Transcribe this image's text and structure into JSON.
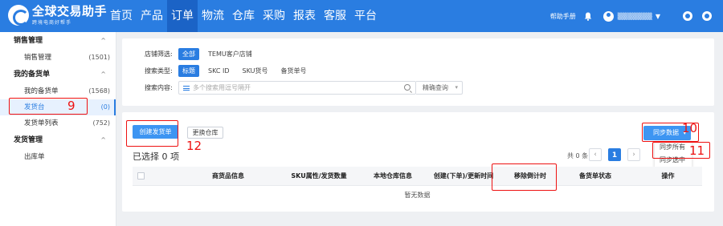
{
  "app": {
    "logo_title": "全球交易助手",
    "logo_sub": "跨境电商好帮手"
  },
  "nav": {
    "items": [
      "首页",
      "产品",
      "订单",
      "物流",
      "仓库",
      "采购",
      "报表",
      "客服",
      "平台"
    ],
    "active_index": 2
  },
  "header": {
    "help": "帮助手册",
    "username": "▒▒▒▒▒▒▒"
  },
  "sidebar": {
    "groups": [
      {
        "label": "销售管理",
        "items": [
          {
            "label": "销售管理",
            "count": "(1501)"
          }
        ]
      },
      {
        "label": "我的备货单",
        "items": [
          {
            "label": "我的备货单",
            "count": "(1568)"
          },
          {
            "label": "发货台",
            "count": "(0)"
          },
          {
            "label": "发货单列表",
            "count": "(752)"
          }
        ]
      },
      {
        "label": "发货管理",
        "items": [
          {
            "label": "出库单",
            "count": ""
          }
        ]
      }
    ],
    "active_item": "发货台"
  },
  "filter": {
    "store_label": "店铺筛选:",
    "store_options": [
      "全部",
      "TEMU客户店铺"
    ],
    "type_label": "搜索类型:",
    "type_options": [
      "标题",
      "SKC ID",
      "SKU货号",
      "备货单号"
    ],
    "content_label": "搜索内容:",
    "search_placeholder": "多个搜索用逗号隔开",
    "search_mode": "精确查询"
  },
  "main": {
    "create_button": "创建发货单",
    "change_warehouse_button": "更换仓库",
    "sync_button": "同步数据",
    "sync_menu": [
      "同步所有",
      "同步选中"
    ],
    "selected_text": "已选择 0 项",
    "total_text": "共 0 条",
    "current_page": "1",
    "prev_icon": "‹",
    "next_icon": "›",
    "columns": [
      "商货品信息",
      "SKU属性/发货数量",
      "本地仓库信息",
      "创建(下单)/更新时间",
      "移除倒计时",
      "备货单状态",
      "操作"
    ],
    "empty_text": "暂无数据"
  },
  "annotations": {
    "labels": [
      "9",
      "10",
      "11",
      "12"
    ],
    "color": "#ee1111"
  },
  "colors": {
    "brand": "#2a7de1",
    "primary_button": "#3d95f2",
    "annotation": "#ee1111"
  }
}
